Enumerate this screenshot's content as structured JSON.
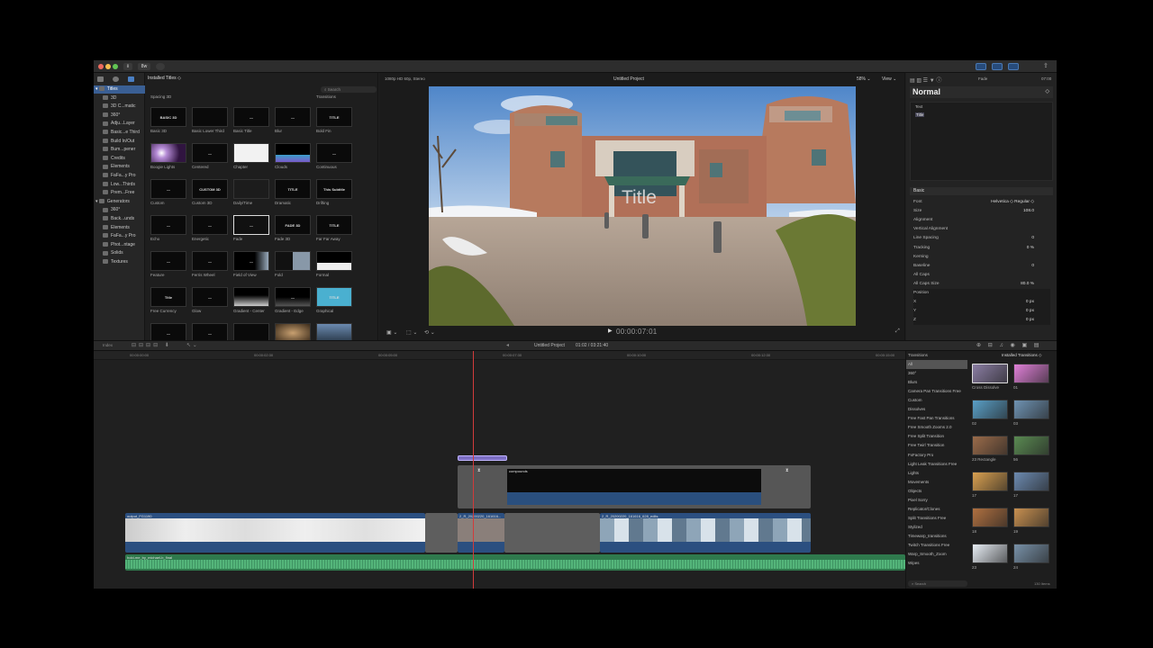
{
  "window": {
    "title": "Untitled Project"
  },
  "toolbar": {
    "btn1": "⊞",
    "btn2": "⬇",
    "btn3": "⏎"
  },
  "browser": {
    "installed_label": "Installed Titles ◇",
    "search_placeholder": "Search",
    "sidebar_items": [
      "Titles",
      "3D",
      "3D C...matic",
      "360°",
      "Adju...Layer",
      "Basic...e Third",
      "Build In/Out",
      "Bum...pener",
      "Credits",
      "Elements",
      "FaFa...y Pro",
      "Low...Thirds",
      "Prem...Free",
      "Generators",
      "360°",
      "Back...unds",
      "Elements",
      "FaFa...y Pro",
      "Phot...ntage",
      "Solids",
      "Textures"
    ],
    "top_labels": [
      "Spacing 3D",
      "",
      "",
      "",
      "Transitions"
    ],
    "tiles": [
      {
        "label": "Basic 3D",
        "text": "BASIC 3D"
      },
      {
        "label": "Basic Lower Third",
        "text": ""
      },
      {
        "label": "Basic Title",
        "text": "—"
      },
      {
        "label": "Blur",
        "text": "—"
      },
      {
        "label": "Bold Fin",
        "text": "TITLE"
      },
      {
        "label": "Boogie Lights",
        "text": ""
      },
      {
        "label": "Centered",
        "text": "—"
      },
      {
        "label": "Chapter",
        "text": ""
      },
      {
        "label": "Clouds",
        "text": ""
      },
      {
        "label": "Continuous",
        "text": "—"
      },
      {
        "label": "Custom",
        "text": "—"
      },
      {
        "label": "Custom 3D",
        "text": "CUSTOM 3D"
      },
      {
        "label": "Daily/Time",
        "text": ""
      },
      {
        "label": "Dramatic",
        "text": "TITLE"
      },
      {
        "label": "Drifting",
        "text": "This Subtitle"
      },
      {
        "label": "Echo",
        "text": "—"
      },
      {
        "label": "Energetic",
        "text": "—"
      },
      {
        "label": "Fade",
        "text": "—"
      },
      {
        "label": "Fade 3D",
        "text": "FADE 3D"
      },
      {
        "label": "Far Far Away",
        "text": "TITLE"
      },
      {
        "label": "Feature",
        "text": "—"
      },
      {
        "label": "Ferris Wheel",
        "text": "—"
      },
      {
        "label": "Field of View",
        "text": "—"
      },
      {
        "label": "Fold",
        "text": ""
      },
      {
        "label": "Formal",
        "text": ""
      },
      {
        "label": "Free Currency",
        "text": "Title"
      },
      {
        "label": "Glow",
        "text": "—"
      },
      {
        "label": "Gradient - Center",
        "text": ""
      },
      {
        "label": "Gradient - Edge",
        "text": "—"
      },
      {
        "label": "Graphical",
        "text": "TITLE"
      },
      {
        "label": "",
        "text": "—"
      },
      {
        "label": "",
        "text": "—"
      },
      {
        "label": "",
        "text": ""
      },
      {
        "label": "",
        "text": ""
      },
      {
        "label": "",
        "text": ""
      }
    ]
  },
  "viewer": {
    "format": "1080p HD 60p, Stereo",
    "project": "Untitled Project",
    "zoom": "58% ⌄",
    "view": "View ⌄",
    "overlay_title": "Title",
    "timecode": "00:00:07:01"
  },
  "inspector": {
    "label": "Fade",
    "duration": "07:00",
    "style": "Normal",
    "text_section": "Text",
    "text_value": "Title",
    "basic_section": "Basic",
    "rows": [
      {
        "k": "Font",
        "v": "Helvetica ◇   Regular ◇"
      },
      {
        "k": "Size",
        "v": "108.0"
      },
      {
        "k": "Alignment",
        "v": ""
      },
      {
        "k": "Vertical Alignment",
        "v": ""
      },
      {
        "k": "Line Spacing",
        "v": "0"
      },
      {
        "k": "Tracking",
        "v": "0 %"
      },
      {
        "k": "Kerning",
        "v": ""
      },
      {
        "k": "Baseline",
        "v": "0"
      },
      {
        "k": "All Caps",
        "v": ""
      },
      {
        "k": "All Caps Size",
        "v": "80.0 %"
      },
      {
        "k": "Position",
        "v": ""
      },
      {
        "k": "X",
        "v": "0 px"
      },
      {
        "k": "Y",
        "v": "0 px"
      },
      {
        "k": "Z",
        "v": "0 px"
      }
    ]
  },
  "timeline": {
    "index": "Index",
    "project_title": "Untitled Project",
    "duration": "01:02 / 03:21:40",
    "ruler": [
      "00:00:00:00",
      "00:00:02:30",
      "00:00:05:00",
      "00:00:07:30",
      "00:00:10:00",
      "00:00:12:30",
      "00:00:15:00"
    ],
    "clips": {
      "title_clip": "",
      "video_top": "compounds",
      "main1": "output_FG1190",
      "main2": "2_R_20200220_161616...",
      "main3": "2_R_20200220_161616_628_edits",
      "audio": "hold-me_by_michael-b_final"
    }
  },
  "transitions": {
    "header": "Transitions",
    "installed": "Installed Transitions ◇",
    "categories": [
      "All",
      "360°",
      "Blurs",
      "Camera Pan Transitions Free",
      "Custom",
      "Dissolves",
      "Free Fast Pan Transitions",
      "Free Smooth Zooms 2.0",
      "Free Split Transition",
      "Free Twirl Transition",
      "FxFactory Pro",
      "Light Leak Transitions Free",
      "Lights",
      "Movements",
      "Objects",
      "Pixel Sorry",
      "Replicator/Clones",
      "Split Transitions Free",
      "Stylized",
      "Timewarp_transitions",
      "Twitch Transitions Free",
      "Warp_Smooth_Zoom",
      "Wipes"
    ],
    "thumbs": [
      {
        "label": "Cross Dissolve",
        "color": "#8a7da3"
      },
      {
        "label": "01",
        "color": "#e080d8"
      },
      {
        "label": "02",
        "color": "#5a9fc7"
      },
      {
        "label": "03",
        "color": "#6f93b3"
      },
      {
        "label": "23 Rectangle",
        "color": "#9a6b4a"
      },
      {
        "label": "56",
        "color": "#5a8a52"
      },
      {
        "label": "17",
        "color": "#d9a050"
      },
      {
        "label": "17",
        "color": "#6c8ab0"
      },
      {
        "label": "18",
        "color": "#b07040"
      },
      {
        "label": "19",
        "color": "#c89050"
      },
      {
        "label": "23",
        "color": "#e8eef5"
      },
      {
        "label": "24",
        "color": "#7891a8"
      }
    ],
    "search_placeholder": "Search",
    "count": "130 Items"
  }
}
